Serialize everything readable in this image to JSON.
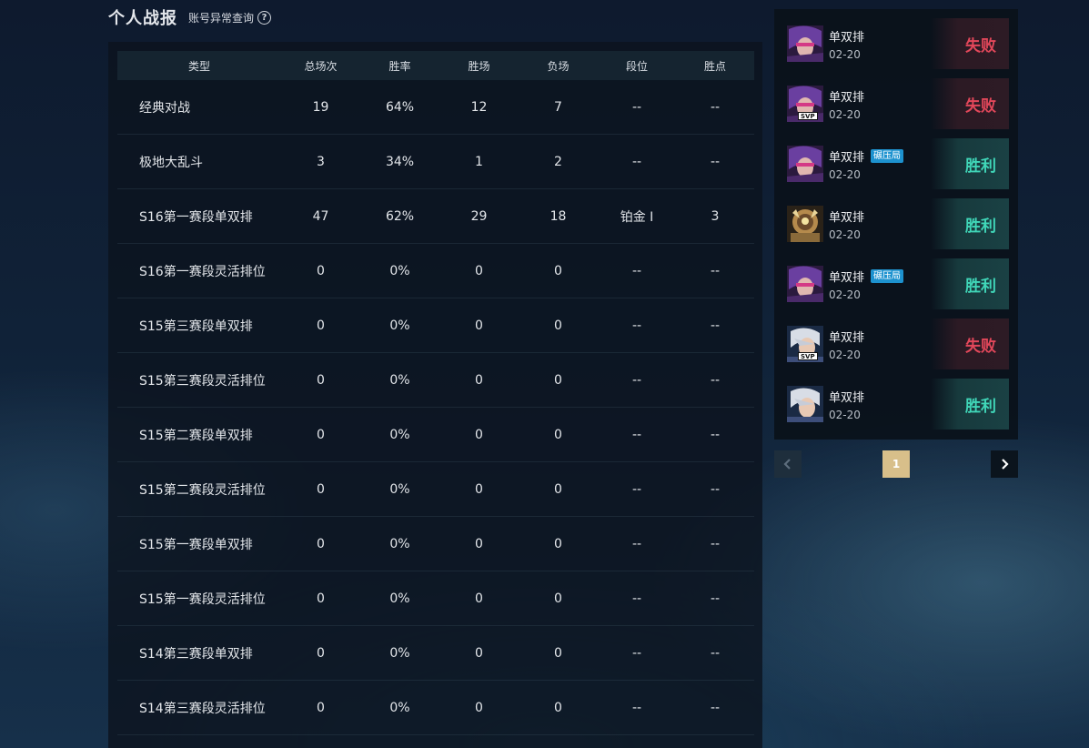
{
  "header": {
    "title": "个人战报",
    "abnormal_link": "账号异常查询",
    "help_glyph": "?"
  },
  "stats": {
    "columns": [
      "类型",
      "总场次",
      "胜率",
      "胜场",
      "负场",
      "段位",
      "胜点"
    ],
    "rows": [
      {
        "type": "经典对战",
        "total": "19",
        "rate": "64%",
        "wins": "12",
        "losses": "7",
        "rank": "--",
        "lp": "--"
      },
      {
        "type": "极地大乱斗",
        "total": "3",
        "rate": "34%",
        "wins": "1",
        "losses": "2",
        "rank": "--",
        "lp": "--"
      },
      {
        "type": "S16第一赛段单双排",
        "total": "47",
        "rate": "62%",
        "wins": "29",
        "losses": "18",
        "rank": "铂金 Ⅰ",
        "lp": "3"
      },
      {
        "type": "S16第一赛段灵活排位",
        "total": "0",
        "rate": "0%",
        "wins": "0",
        "losses": "0",
        "rank": "--",
        "lp": "--"
      },
      {
        "type": "S15第三赛段单双排",
        "total": "0",
        "rate": "0%",
        "wins": "0",
        "losses": "0",
        "rank": "--",
        "lp": "--"
      },
      {
        "type": "S15第三赛段灵活排位",
        "total": "0",
        "rate": "0%",
        "wins": "0",
        "losses": "0",
        "rank": "--",
        "lp": "--"
      },
      {
        "type": "S15第二赛段单双排",
        "total": "0",
        "rate": "0%",
        "wins": "0",
        "losses": "0",
        "rank": "--",
        "lp": "--"
      },
      {
        "type": "S15第二赛段灵活排位",
        "total": "0",
        "rate": "0%",
        "wins": "0",
        "losses": "0",
        "rank": "--",
        "lp": "--"
      },
      {
        "type": "S15第一赛段单双排",
        "total": "0",
        "rate": "0%",
        "wins": "0",
        "losses": "0",
        "rank": "--",
        "lp": "--"
      },
      {
        "type": "S15第一赛段灵活排位",
        "total": "0",
        "rate": "0%",
        "wins": "0",
        "losses": "0",
        "rank": "--",
        "lp": "--"
      },
      {
        "type": "S14第三赛段单双排",
        "total": "0",
        "rate": "0%",
        "wins": "0",
        "losses": "0",
        "rank": "--",
        "lp": "--"
      },
      {
        "type": "S14第三赛段灵活排位",
        "total": "0",
        "rate": "0%",
        "wins": "0",
        "losses": "0",
        "rank": "--",
        "lp": "--"
      }
    ]
  },
  "matches": [
    {
      "mode": "单双排",
      "date": "02-20",
      "result": "失败",
      "badge": "",
      "svp": "",
      "champ_icon": "purple-marksman-portrait"
    },
    {
      "mode": "单双排",
      "date": "02-20",
      "result": "失败",
      "badge": "",
      "svp": "SVP",
      "champ_icon": "purple-marksman-portrait"
    },
    {
      "mode": "单双排",
      "date": "02-20",
      "result": "胜利",
      "badge": "碾压局",
      "svp": "",
      "champ_icon": "purple-marksman-portrait"
    },
    {
      "mode": "单双排",
      "date": "02-20",
      "result": "胜利",
      "badge": "",
      "svp": "",
      "champ_icon": "golden-armored-portrait"
    },
    {
      "mode": "单双排",
      "date": "02-20",
      "result": "胜利",
      "badge": "碾压局",
      "svp": "",
      "champ_icon": "purple-marksman-portrait"
    },
    {
      "mode": "单双排",
      "date": "02-20",
      "result": "失败",
      "badge": "",
      "svp": "SVP",
      "champ_icon": "silver-haired-portrait"
    },
    {
      "mode": "单双排",
      "date": "02-20",
      "result": "胜利",
      "badge": "",
      "svp": "",
      "champ_icon": "silver-haired-portrait"
    }
  ],
  "pagination": {
    "current_page": "1",
    "prev_icon": "chevron-left-icon",
    "next_icon": "chevron-right-icon"
  },
  "colors": {
    "win": "#40d6b8",
    "lose": "#e2475a",
    "active_page": "#d8bf8a",
    "crush_badge": "#1d92cf"
  }
}
